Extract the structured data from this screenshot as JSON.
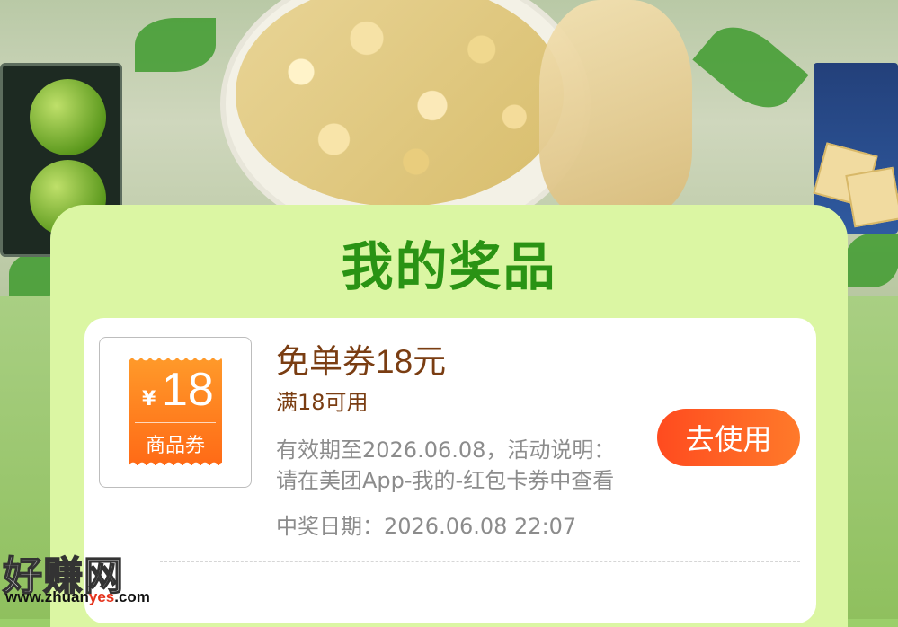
{
  "modal": {
    "title": "我的奖品"
  },
  "prize": {
    "thumbnail": {
      "currency": "¥",
      "amount": "18",
      "label": "商品券"
    },
    "name": "免单券18元",
    "condition": "满18可用",
    "description_line1": "有效期至2026.06.08，活动说明：",
    "description_line2": "请在美团App-我的-红包卡券中查看",
    "won_date": "中奖日期：2026.06.08 22:07",
    "action_label": "去使用"
  },
  "watermark": {
    "logo_text": "好赚网",
    "url_prefix": "www.zhuan",
    "url_highlight": "yes",
    "url_suffix": ".com"
  },
  "colors": {
    "title_green": "#2a9314",
    "panel_bg": "#dbf6a3",
    "prize_brown": "#7a3d12",
    "button_orange": "#ff5a22",
    "ticket_orange": "#ff7f1f"
  }
}
